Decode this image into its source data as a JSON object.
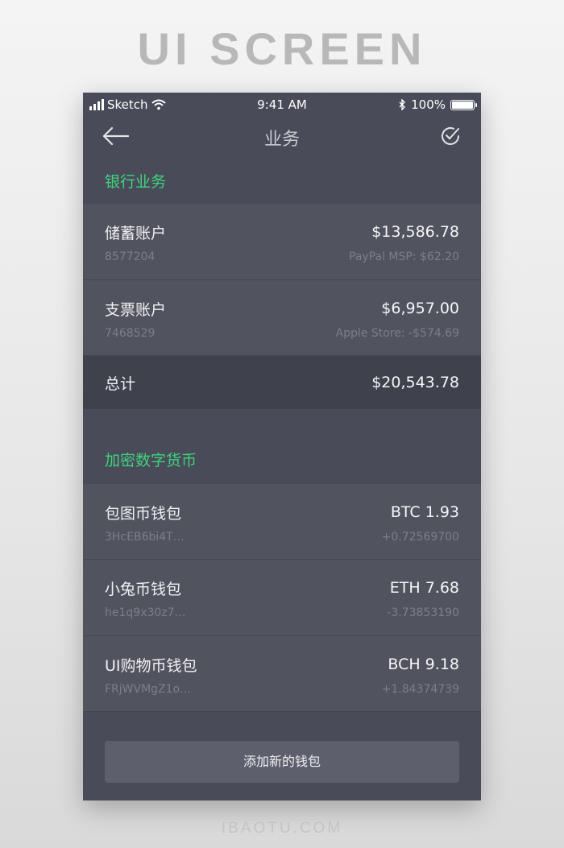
{
  "banner": "UI SCREEN",
  "footer": "IBAOTU.COM",
  "status_bar": {
    "carrier": "Sketch",
    "time": "9:41 AM",
    "battery": "100%"
  },
  "nav": {
    "title": "业务",
    "back_icon": "arrow-left-icon",
    "action_icon": "check-circle-icon"
  },
  "bank_section": {
    "title": "银行业务",
    "accounts": [
      {
        "name": "储蓄账户",
        "number": "8577204",
        "amount": "$13,586.78",
        "note": "PayPal MSP: $62.20"
      },
      {
        "name": "支票账户",
        "number": "7468529",
        "amount": "$6,957.00",
        "note": "Apple Store: -$574.69"
      }
    ],
    "total_label": "总计",
    "total_amount": "$20,543.78"
  },
  "crypto_section": {
    "title": "加密数字货币",
    "wallets": [
      {
        "name": "包图币钱包",
        "address": "3HcEB6bi4T…",
        "amount": "BTC 1.93",
        "change": "+0.72569700"
      },
      {
        "name": "小兔币钱包",
        "address": "he1q9x30z7…",
        "amount": "ETH 7.68",
        "change": "-3.73853190"
      },
      {
        "name": "UI购物币钱包",
        "address": "FRjWVMgZ1o…",
        "amount": "BCH 9.18",
        "change": "+1.84374739"
      }
    ]
  },
  "add_wallet_button": "添加新的钱包",
  "colors": {
    "accent": "#3fd37c",
    "background": "#494b59",
    "row": "#51535f",
    "total_row": "#3f414d",
    "button": "#5d5f6d"
  }
}
